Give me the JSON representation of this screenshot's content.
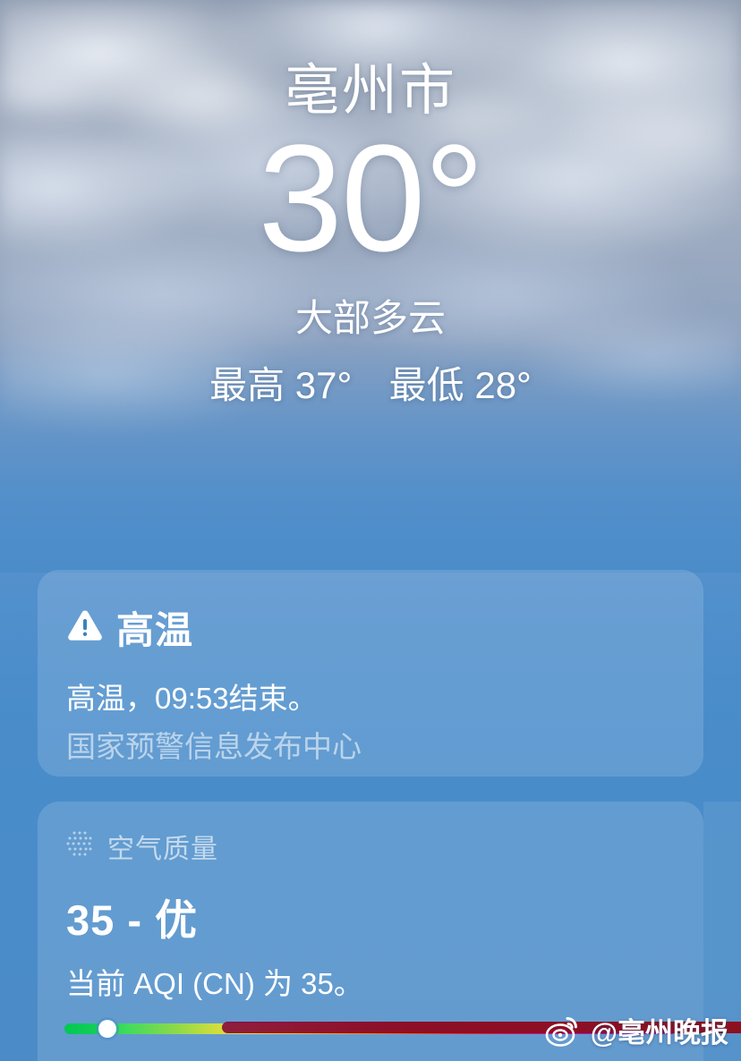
{
  "app": "weather",
  "hero": {
    "city": "亳州市",
    "temperature": "30°",
    "condition": "大部多云",
    "high_label": "最高 37°",
    "low_label": "最低 28°"
  },
  "warning_card": {
    "icon": "warning-triangle-icon",
    "title": "高温",
    "body": "高温，09:53结束。",
    "source": "国家预警信息发布中心"
  },
  "air_quality_card": {
    "icon": "air-quality-dots-icon",
    "label": "空气质量",
    "value": "35 - 优",
    "description": "当前 AQI (CN) 为 35。",
    "scale_position_percent": 7
  },
  "watermark": {
    "icon": "weibo-logo-icon",
    "text": "@亳州晚报"
  },
  "colors": {
    "sky_top": "#8e9bb0",
    "sky_bottom": "#4b8bc8",
    "card_fill": "rgba(255,255,255,0.14)",
    "text": "#ffffff",
    "muted_text": "rgba(255,255,255,0.56)",
    "aqi_good": "#00c853",
    "watermark_banner": "#8b0f26"
  },
  "chart_data": {
    "type": "bar",
    "title": "空气质量",
    "categories": [
      "AQI (CN)"
    ],
    "values": [
      35
    ],
    "xlabel": "",
    "ylabel": "AQI",
    "ylim": [
      0,
      500
    ],
    "annotations": [
      "35 - 优"
    ]
  }
}
